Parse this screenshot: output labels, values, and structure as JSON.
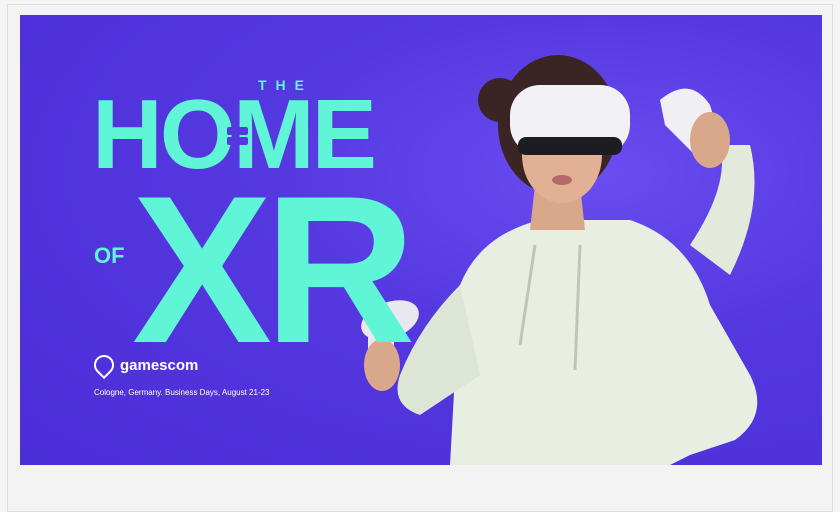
{
  "banner": {
    "the": "THE",
    "home": "HOME",
    "of": "OF",
    "xr": "XR",
    "logo_text": "gamescom",
    "tagline": "Cologne, Germany. Business Days, August 21-23",
    "colors": {
      "background": "#5538e0",
      "accent": "#5ff5d6",
      "text": "#ffffff"
    }
  }
}
